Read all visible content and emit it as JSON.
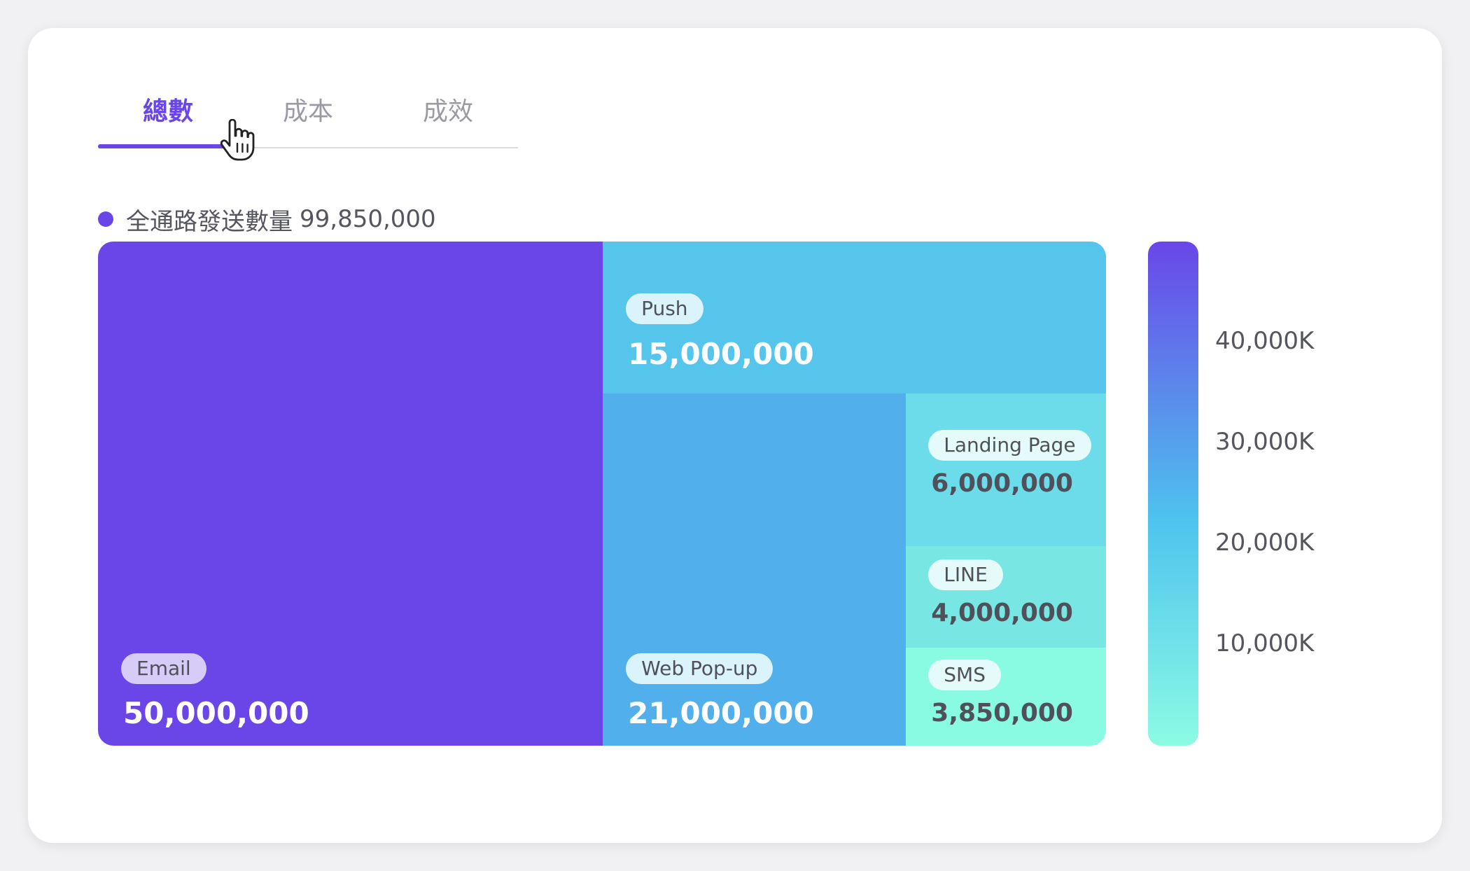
{
  "tabs": [
    {
      "label": "總數",
      "active": true
    },
    {
      "label": "成本",
      "active": false
    },
    {
      "label": "成效",
      "active": false
    }
  ],
  "legend": {
    "label": "全通路發送數量",
    "total": "99,850,000"
  },
  "colors": {
    "accent": "#6a46e8",
    "tab_inactive": "#9a9aa5"
  },
  "chart_data": {
    "type": "treemap",
    "total": 99850000,
    "items": [
      {
        "name": "Email",
        "value": 50000000,
        "display": "50,000,000",
        "color": "#6a46e8"
      },
      {
        "name": "Web Pop-up",
        "value": 21000000,
        "display": "21,000,000",
        "color": "#51b0ec"
      },
      {
        "name": "Push",
        "value": 15000000,
        "display": "15,000,000",
        "color": "#56c5ec"
      },
      {
        "name": "Landing Page",
        "value": 6000000,
        "display": "6,000,000",
        "color": "#6cdcea"
      },
      {
        "name": "LINE",
        "value": 4000000,
        "display": "4,000,000",
        "color": "#78e7e4"
      },
      {
        "name": "SMS",
        "value": 3850000,
        "display": "3,850,000",
        "color": "#89fbe2"
      }
    ],
    "color_scale": {
      "min": 0,
      "max": 50000,
      "ticks": [
        {
          "value": 40000,
          "label": "40,000K"
        },
        {
          "value": 30000,
          "label": "30,000K"
        },
        {
          "value": 20000,
          "label": "20,000K"
        },
        {
          "value": 10000,
          "label": "10,000K"
        }
      ],
      "color_top": "#6a46e8",
      "color_mid": "#4ec3ee",
      "color_bottom": "#8cfbe4"
    }
  }
}
